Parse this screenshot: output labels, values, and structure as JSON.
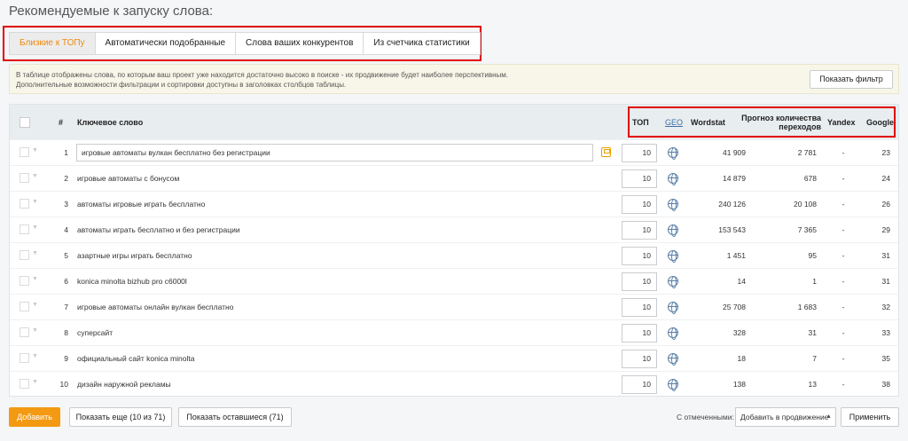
{
  "page_title": "Рекомендуемые к запуску слова:",
  "tabs": [
    {
      "label": "Близкие к ТОПу",
      "active": true
    },
    {
      "label": "Автоматически подобранные",
      "active": false
    },
    {
      "label": "Слова ваших конкурентов",
      "active": false
    },
    {
      "label": "Из счетчика статистики",
      "active": false
    }
  ],
  "info": {
    "line1": "В таблице отображены слова, по которым ваш проект уже находится достаточно высоко в поиске - их продвижение будет наиболее перспективным.",
    "line2": "Дополнительные возможности фильтрации и сортировки доступны в заголовках столбцов таблицы.",
    "filter_button": "Показать фильтр"
  },
  "columns": {
    "num": "#",
    "keyword": "Ключевое слово",
    "top": "ТОП",
    "geo": "GEO",
    "wordstat": "Wordstat",
    "forecast_1": "Прогноз количества",
    "forecast_2": "переходов",
    "yandex": "Yandex",
    "google": "Google"
  },
  "rows": [
    {
      "num": "1",
      "keyword": "игровые автоматы вулкан бесплатно без регистрации",
      "top": "10",
      "wordstat": "41 909",
      "forecast": "2 781",
      "yandex": "-",
      "google": "23"
    },
    {
      "num": "2",
      "keyword": "игровые автоматы с бонусом",
      "top": "10",
      "wordstat": "14 879",
      "forecast": "678",
      "yandex": "-",
      "google": "24"
    },
    {
      "num": "3",
      "keyword": "автоматы игровые играть бесплатно",
      "top": "10",
      "wordstat": "240 126",
      "forecast": "20 108",
      "yandex": "-",
      "google": "26"
    },
    {
      "num": "4",
      "keyword": "автоматы играть бесплатно и без регистрации",
      "top": "10",
      "wordstat": "153 543",
      "forecast": "7 365",
      "yandex": "-",
      "google": "29"
    },
    {
      "num": "5",
      "keyword": "азартные игры играть бесплатно",
      "top": "10",
      "wordstat": "1 451",
      "forecast": "95",
      "yandex": "-",
      "google": "31"
    },
    {
      "num": "6",
      "keyword": "konica minolta bizhub pro c6000l",
      "top": "10",
      "wordstat": "14",
      "forecast": "1",
      "yandex": "-",
      "google": "31"
    },
    {
      "num": "7",
      "keyword": "игровые автоматы онлайн вулкан бесплатно",
      "top": "10",
      "wordstat": "25 708",
      "forecast": "1 683",
      "yandex": "-",
      "google": "32"
    },
    {
      "num": "8",
      "keyword": "суперсайт",
      "top": "10",
      "wordstat": "328",
      "forecast": "31",
      "yandex": "-",
      "google": "33"
    },
    {
      "num": "9",
      "keyword": "официальный сайт konica minolta",
      "top": "10",
      "wordstat": "18",
      "forecast": "7",
      "yandex": "-",
      "google": "35"
    },
    {
      "num": "10",
      "keyword": "дизайн наружной рекламы",
      "top": "10",
      "wordstat": "138",
      "forecast": "13",
      "yandex": "-",
      "google": "38"
    }
  ],
  "footer": {
    "add_button": "Добавить",
    "more_button": "Показать еще (10 из 71)",
    "rest_button": "Показать оставшиеся (71)",
    "with_selected_label": "С отмеченными:",
    "action_select": "Добавить в продвижение",
    "apply_button": "Применить"
  },
  "colors": {
    "accent": "#f39a12",
    "highlight": "#e00000",
    "link": "#3d6fa8"
  }
}
